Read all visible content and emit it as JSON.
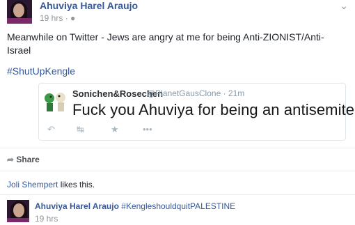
{
  "post": {
    "author": "Ahuviya Harel Araujo",
    "time": "19 hrs",
    "body": "Meanwhile on Twitter - Jews are angry at me for being Anti-ZIONIST/Anti-Israel",
    "hashtag": "#ShutUpKengle",
    "options_icon": "chevron-down-icon"
  },
  "tweet": {
    "name": "Sonichen&Rosechen",
    "handle": "@PlanetGausClone · 21m",
    "text": "Fuck you Ahuviya for being an antisemite.",
    "actions": [
      "reply-icon",
      "retweet-icon",
      "favorite-icon",
      "more-icon"
    ]
  },
  "actions": {
    "share_label": "Share"
  },
  "likes": {
    "name": "Joli Shempert",
    "suffix": " likes this."
  },
  "comment": {
    "author": "Ahuviya Harel Araujo",
    "text": "#KengleshouldquitPALESTINE",
    "time": "19 hrs"
  }
}
